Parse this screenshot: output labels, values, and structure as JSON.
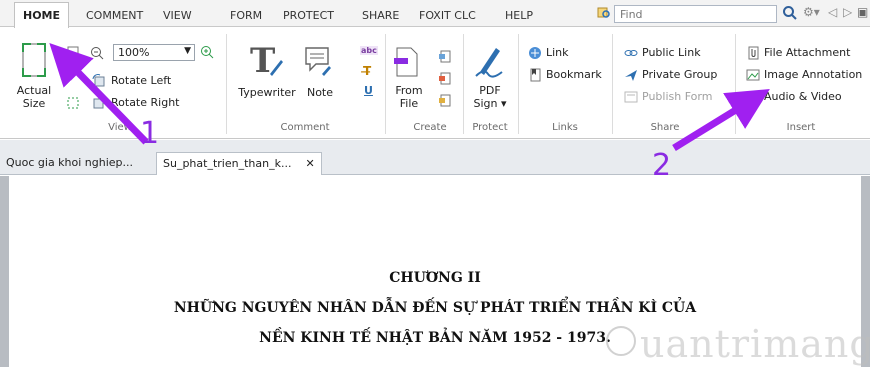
{
  "ribbon_tabs": [
    "HOME",
    "COMMENT",
    "VIEW",
    "FORM",
    "PROTECT",
    "SHARE",
    "FOXIT CLC",
    "HELP"
  ],
  "find_placeholder": "Find",
  "view_group": {
    "actual_size": "Actual\nSize",
    "zoom_value": "100%",
    "rotate_left": "Rotate Left",
    "rotate_right": "Rotate Right",
    "label": "View"
  },
  "comment_group": {
    "typewriter": "Typewriter",
    "note": "Note",
    "label": "Comment"
  },
  "create_group": {
    "from_file_1": "From",
    "from_file_2": "File",
    "label": "Create"
  },
  "protect_group": {
    "pdf_sign_1": "PDF",
    "pdf_sign_2": "Sign ▾",
    "label": "Protect"
  },
  "links_group": {
    "link": "Link",
    "bookmark": "Bookmark",
    "label": "Links"
  },
  "share_group": {
    "public_link": "Public Link",
    "private_group": "Private Group",
    "publish_form": "Publish Form",
    "label": "Share"
  },
  "insert_group": {
    "file_attachment": "File Attachment",
    "image_annotation": "Image Annotation",
    "audio_video": "Audio & Video",
    "label": "Insert"
  },
  "doc_tabs": [
    "Quoc gia khoi nghiep...",
    "Su_phat_trien_than_k..."
  ],
  "document": {
    "heading": "CHƯƠNG II",
    "line1": "NHỮNG NGUYÊN NHÂN DẪN ĐẾN SỰ PHÁT TRIỂN THẦN KÌ CỦA",
    "line2": "NỀN KINH TẾ NHẬT BẢN NĂM 1952 - 1973."
  },
  "annotations": {
    "one": "1",
    "two": "2"
  },
  "watermark": "uantrimang",
  "colors": {
    "arrow": "#a020f0",
    "ribbon_bg": "#ffffff",
    "tab_bar": "#f3f3f3",
    "workspace": "#b8bcc2"
  }
}
